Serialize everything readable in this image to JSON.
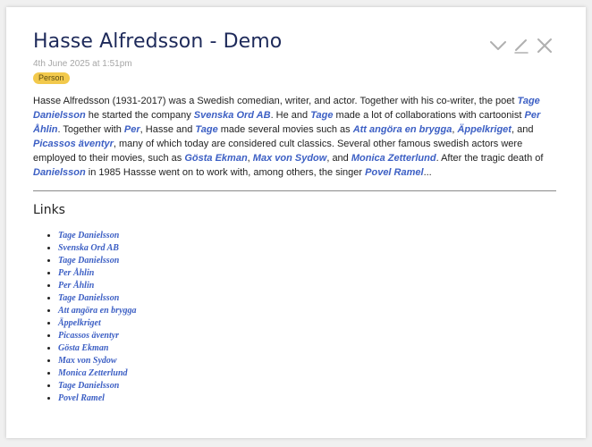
{
  "entry": {
    "title": "Hasse Alfredsson - Demo",
    "timestamp": "4th June 2025 at 1:51pm",
    "tag": "Person"
  },
  "toolbar": {
    "collapse_icon": "chevron-down-icon",
    "edit_icon": "pencil-icon",
    "close_icon": "close-icon"
  },
  "body": {
    "s1": "Hasse Alfredsson (1931-2017) was a Swedish comedian, writer, and actor. Together with his co-writer, the poet ",
    "l1": "Tage Danielsson",
    "s2": " he started the company ",
    "l2": "Svenska Ord AB",
    "s3": ". He and ",
    "l3": "Tage",
    "s4": " made a lot of collaborations with cartoonist ",
    "l4": "Per Åhlin",
    "s5": ". Together with ",
    "l5": "Per",
    "s6": ", Hasse and ",
    "l6": "Tage",
    "s7": " made several movies such as ",
    "l7": "Att angöra en brygga",
    "s8": ", ",
    "l8": "Äppelkriget",
    "s9": ", and ",
    "l9": "Picassos äventyr",
    "s10": ", many of which today are considered cult classics. Several other famous swedish actors were employed to their movies, such as ",
    "l10": "Gösta Ekman",
    "s11": ", ",
    "l11": "Max von Sydow",
    "s12": ", and ",
    "l12": "Monica Zetterlund",
    "s13": ". After the tragic death of ",
    "l13": "Danielsson",
    "s14": " in 1985 Hassse went on to work with, among others, the singer ",
    "l14": "Povel Ramel",
    "s15": "..."
  },
  "links": {
    "heading": "Links",
    "items": [
      "Tage Danielsson",
      "Svenska Ord AB",
      "Tage Danielsson",
      "Per Åhlin",
      "Per Åhlin",
      "Tage Danielsson",
      "Att angöra en brygga",
      "Äppelkriget",
      "Picassos äventyr",
      "Gösta Ekman",
      "Max von Sydow",
      "Monica Zetterlund",
      "Tage Danielsson",
      "Povel Ramel"
    ]
  },
  "colors": {
    "title": "#1e2a5a",
    "link": "#3c5fc4",
    "tag_bg": "#f2c94c",
    "icon": "#b0b0b0"
  }
}
